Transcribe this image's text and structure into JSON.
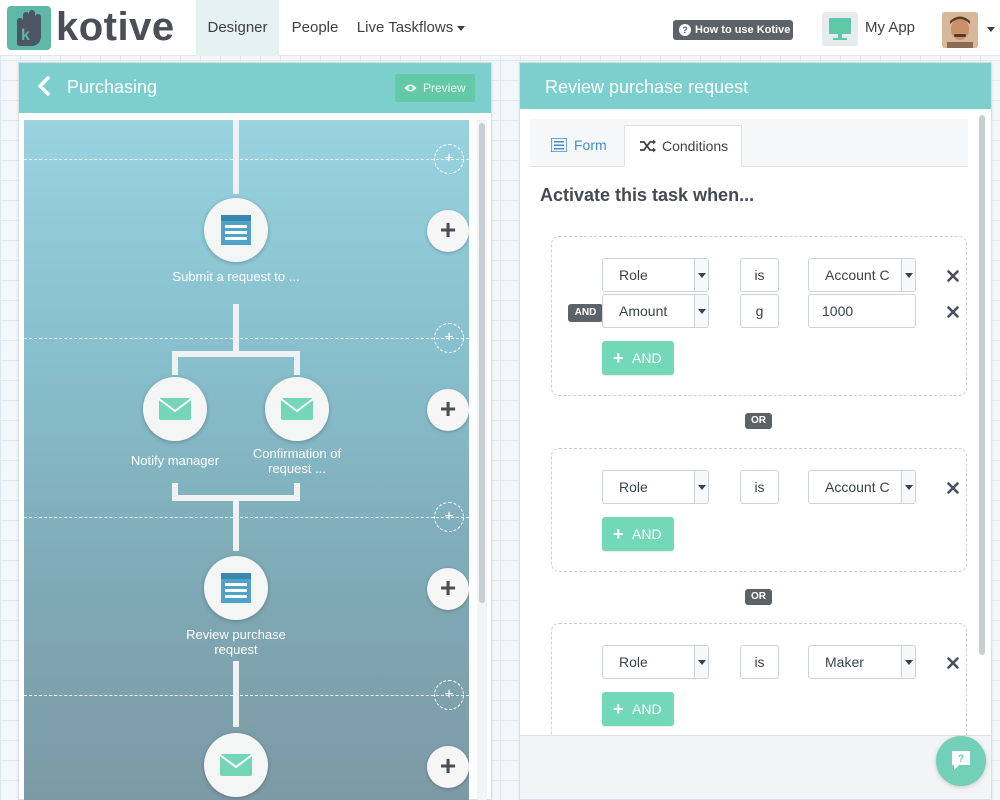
{
  "brand": {
    "name": "kotive"
  },
  "nav": {
    "tabs": [
      {
        "label": "Designer",
        "active": true
      },
      {
        "label": "People"
      },
      {
        "label": "Live Taskflows"
      }
    ],
    "help_label": "How to use Kotive",
    "app_label": "My App"
  },
  "left_panel": {
    "title": "Purchasing",
    "preview_label": "Preview",
    "nodes": [
      {
        "label": "Submit a request to ...",
        "icon": "form-icon"
      },
      {
        "label": "Notify manager",
        "icon": "email-icon"
      },
      {
        "label": "Confirmation of request ...",
        "icon": "email-icon"
      },
      {
        "label": "Review purchase request",
        "icon": "form-icon"
      },
      {
        "label": "",
        "icon": "email-icon"
      }
    ],
    "add_small": "+",
    "add_big": "+"
  },
  "right_panel": {
    "title": "Review purchase request",
    "tabs": [
      {
        "label": "Form"
      },
      {
        "label": "Conditions",
        "active": true
      }
    ],
    "heading": "Activate this task when...",
    "groups": [
      {
        "conditions": [
          {
            "field": "Role",
            "operator": "is",
            "value": "Account C"
          },
          {
            "connector": "AND",
            "field": "Amount",
            "operator": "g",
            "value": "1000"
          }
        ],
        "add_label": "AND"
      },
      {
        "conditions": [
          {
            "field": "Role",
            "operator": "is",
            "value": "Account C"
          }
        ],
        "add_label": "AND"
      },
      {
        "conditions": [
          {
            "field": "Role",
            "operator": "is",
            "value": "Maker"
          }
        ],
        "add_label": "AND"
      }
    ],
    "or_label": "OR"
  },
  "colors": {
    "accent": "#7ccfcc",
    "add_button": "#73d8b8",
    "badge": "#5d6268"
  }
}
